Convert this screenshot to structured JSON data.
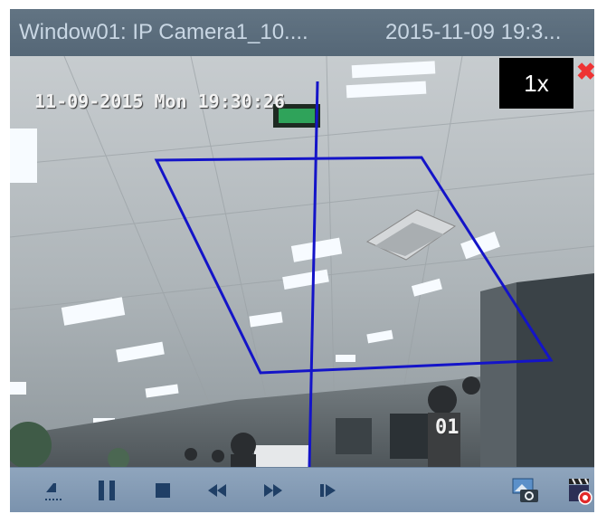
{
  "window": {
    "title": "Window01: IP Camera1_10....",
    "timestamp": "2015-11-09 19:3...",
    "close_glyph": "✖"
  },
  "video": {
    "osd_datetime": "11-09-2015 Mon 19:30:26",
    "camera_label": "01",
    "speed": "1x",
    "overlay_color": "#1414c8"
  },
  "toolbar": {
    "buttons": [
      {
        "name": "step-back-icon"
      },
      {
        "name": "pause-icon"
      },
      {
        "name": "stop-icon"
      },
      {
        "name": "rewind-icon"
      },
      {
        "name": "fast-forward-icon"
      },
      {
        "name": "single-frame-icon"
      },
      {
        "name": "snapshot-icon"
      },
      {
        "name": "clip-record-icon"
      }
    ]
  }
}
